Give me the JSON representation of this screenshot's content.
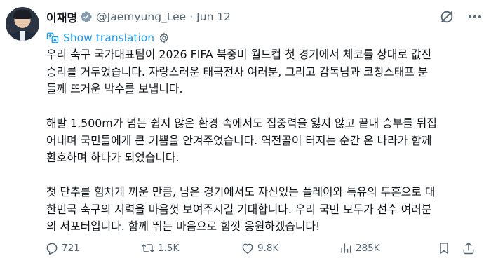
{
  "author": {
    "name": "이재명",
    "handle": "@Jaemyung_Lee",
    "separator": "·",
    "date": "Jun 12"
  },
  "translate_label": "Show translation",
  "paragraphs": [
    {
      "lines": [
        "우리 축구 국가대표팀이 2026 FIFA 북중미 월드컵 첫 경기에서 체코를 상대로 값진",
        "승리를 거두었습니다. 자랑스러운 태극전사 여러분, 그리고 감독님과 코칭스태프 분",
        "들께 뜨거운 박수를 보냅니다."
      ]
    },
    {
      "lines": [
        "해발 1,500m가 넘는 쉽지 않은 환경 속에서도 집중력을 잃지 않고 끝내 승부를 뒤집",
        "어내며 국민들에게 큰 기쁨을 안겨주었습니다. 역전골이 터지는 순간 온 나라가 함께",
        "환호하며 하나가 되었습니다."
      ]
    },
    {
      "lines": [
        "첫 단추를 힘차게 끼운 만큼, 남은 경기에서도 자신있는 플레이와 특유의 투혼으로 대",
        "한민국 축구의 저력을 마음껏 보여주시길 기대합니다. 우리 국민 모두가 선수 여러분",
        "의 서포터입니다. 함께 뛰는 마음으로 힘껏 응원하겠습니다!"
      ]
    }
  ],
  "stats": {
    "replies": "721",
    "reposts": "1.5K",
    "likes": "9.8K",
    "views": "285K"
  },
  "colors": {
    "text": "#0f1419",
    "secondary": "#536471",
    "accent": "#1d9bf0",
    "verified": "#829aab"
  },
  "icons": [
    "avatar",
    "verified-badge-icon",
    "grok-icon",
    "more-icon",
    "translate-icon",
    "settings-gear-icon",
    "reply-icon",
    "repost-icon",
    "like-icon",
    "views-icon",
    "bookmark-icon",
    "share-icon"
  ]
}
